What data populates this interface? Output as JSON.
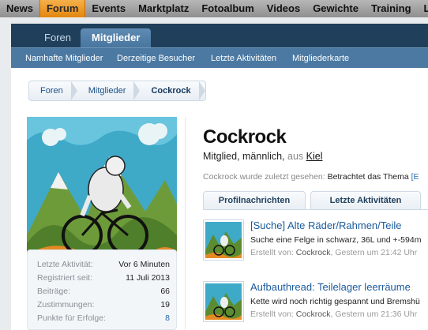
{
  "top_nav": [
    "News",
    "Forum",
    "Events",
    "Marktplatz",
    "Fotoalbum",
    "Videos",
    "Gewichte",
    "Training",
    "Last M"
  ],
  "tabs": [
    "Foren",
    "Mitglieder"
  ],
  "subnav": [
    "Namhafte Mitglieder",
    "Derzeitige Besucher",
    "Letzte Aktivitäten",
    "Mitgliederkarte"
  ],
  "breadcrumbs": [
    "Foren",
    "Mitglieder",
    "Cockrock"
  ],
  "profile": {
    "username": "Cockrock",
    "role": "Mitglied, männlich,",
    "from": "aus",
    "location": "Kiel",
    "last_seen_label": "Cockrock wurde zuletzt gesehen:",
    "last_seen_value": "Betrachtet das Thema",
    "last_seen_extra": "[E"
  },
  "stats": [
    {
      "label": "Letzte Aktivität:",
      "value": "Vor 6 Minuten"
    },
    {
      "label": "Registriert seit:",
      "value": "11 Juli 2013"
    },
    {
      "label": "Beiträge:",
      "value": "66"
    },
    {
      "label": "Zustimmungen:",
      "value": "19"
    },
    {
      "label": "Punkte für Erfolge:",
      "value": "8"
    }
  ],
  "profile_tabs": [
    "Profilnachrichten",
    "Letzte Aktivitäten"
  ],
  "posts": [
    {
      "title": "[Suche] Alte Räder/Rahmen/Teile",
      "desc": "Suche eine Felge in schwarz, 36L und +-594m",
      "meta_prefix": "Erstellt von:",
      "author": "Cockrock",
      "time": ", Gestern um 21:42 Uhr"
    },
    {
      "title": "Aufbauthread: Teilelager leerräume",
      "desc": "Kette wird noch richtig gespannt und Bremshü",
      "meta_prefix": "Erstellt von:",
      "author": "Cockrock",
      "time": ", Gestern um 21:36 Uhr"
    }
  ],
  "colors": {
    "accent_orange": "#e2860f",
    "nav_dark": "#1f3f5b",
    "nav_blue": "#4b79a2",
    "link": "#1b5a9c"
  }
}
